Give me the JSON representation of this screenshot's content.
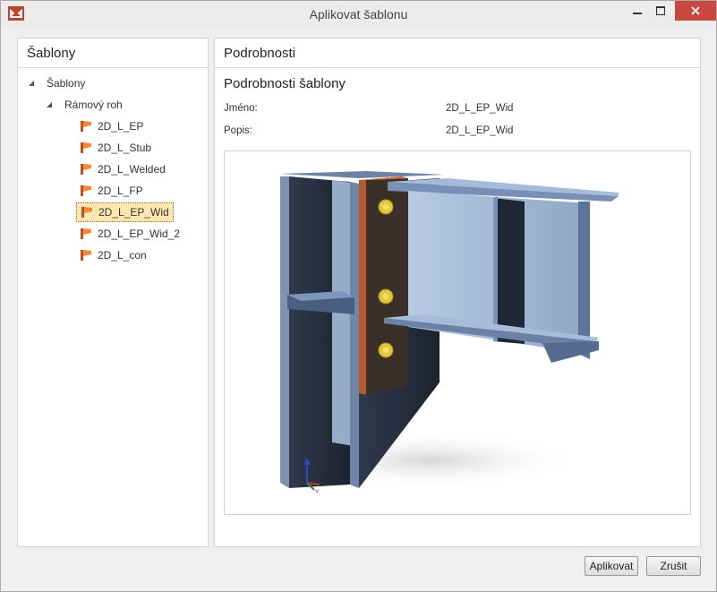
{
  "window": {
    "title": "Aplikovat šablonu"
  },
  "left_panel": {
    "header": "Šablony",
    "tree": {
      "root_label": "Šablony",
      "group_label": "Rámový roh",
      "items": [
        {
          "label": "2D_L_EP",
          "selected": false
        },
        {
          "label": "2D_L_Stub",
          "selected": false
        },
        {
          "label": "2D_L_Welded",
          "selected": false
        },
        {
          "label": "2D_L_FP",
          "selected": false
        },
        {
          "label": "2D_L_EP_Wid",
          "selected": true
        },
        {
          "label": "2D_L_EP_Wid_2",
          "selected": false
        },
        {
          "label": "2D_L_con",
          "selected": false
        }
      ]
    }
  },
  "right_panel": {
    "header": "Podrobnosti",
    "section_title": "Podrobnosti šablony",
    "name_label": "Jméno:",
    "name_value": "2D_L_EP_Wid",
    "desc_label": "Popis:",
    "desc_value": "2D_L_EP_Wid",
    "preview": {
      "axis_z": "Z",
      "axis_x": "X",
      "axis_y": "Y"
    }
  },
  "buttons": {
    "apply_label": "Aplikovat",
    "cancel_label": "Zrušit"
  },
  "colors": {
    "selection": "#fde7b0",
    "close_button": "#c7483f",
    "steel": "#9fb4d0",
    "end_plate": "#d2692e",
    "bolt": "#e3c63a"
  }
}
